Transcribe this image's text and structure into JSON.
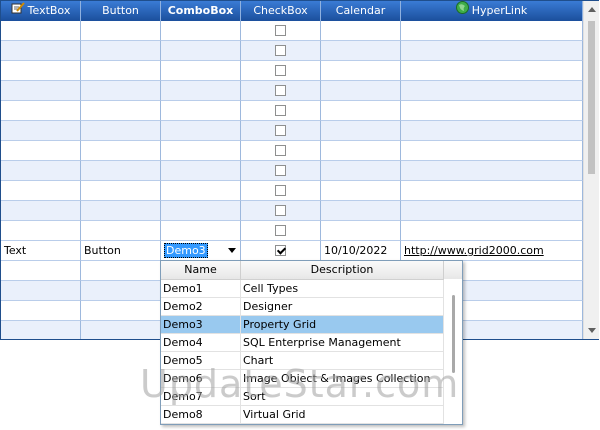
{
  "grid": {
    "columns": [
      {
        "label": "TextBox",
        "icon": "notepad-pencil-icon",
        "bold": false
      },
      {
        "label": "Button",
        "bold": false
      },
      {
        "label": "ComboBox",
        "bold": true
      },
      {
        "label": "CheckBox",
        "bold": false
      },
      {
        "label": "Calendar",
        "bold": false
      },
      {
        "label": "HyperLink",
        "icon": "globe-icon",
        "bold": false
      }
    ],
    "empty_rows_before": 11,
    "active_row": {
      "textbox": "Text",
      "button": "Button",
      "combobox": "Demo3",
      "checkbox_checked": true,
      "calendar": "10/10/2022",
      "hyperlink": "http://www.grid2000.com"
    },
    "empty_rows_after": 4
  },
  "dropdown": {
    "columns": [
      "Name",
      "Description"
    ],
    "items": [
      {
        "name": "Demo1",
        "description": "Cell Types"
      },
      {
        "name": "Demo2",
        "description": "Designer"
      },
      {
        "name": "Demo3",
        "description": "Property Grid"
      },
      {
        "name": "Demo4",
        "description": "SQL Enterprise Management"
      },
      {
        "name": "Demo5",
        "description": "Chart"
      },
      {
        "name": "Demo6",
        "description": "Image Object & Images Collection"
      },
      {
        "name": "Demo7",
        "description": "Sort"
      },
      {
        "name": "Demo8",
        "description": "Virtual Grid"
      }
    ],
    "selected_index": 2
  },
  "watermark": "UpdateStar.com",
  "colors": {
    "header_bg": "#2b63b8",
    "row_alt": "#eaf0fb",
    "selection": "#99c9ef",
    "combo_highlight": "#3399ff"
  }
}
